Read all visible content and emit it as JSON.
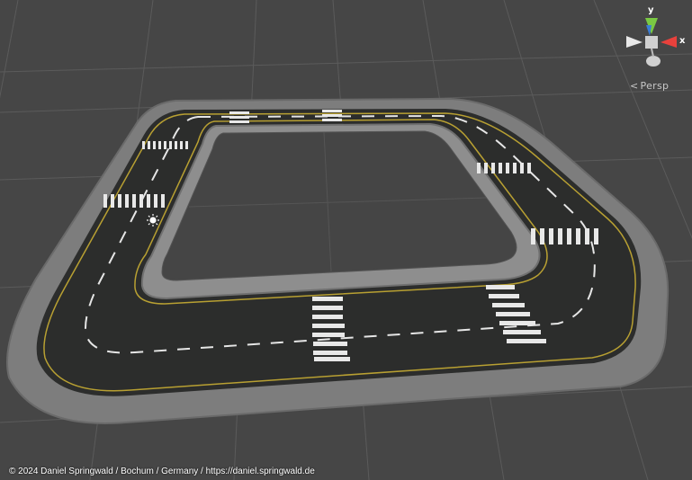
{
  "scene": {
    "view_mode": "Persp",
    "gizmo": {
      "y_label": "y",
      "x_label": "x"
    },
    "colors": {
      "background": "#464646",
      "grid_line": "#5c5c5c",
      "curb": "#8a8a8a",
      "curb_dark": "#6e6e6e",
      "asphalt": "#2a2b2a",
      "edge_line": "#b8a032",
      "lane_marking": "#e8e8e8",
      "gizmo_y": "#7ac943",
      "gizmo_x": "#e8413c",
      "gizmo_z": "#3a7fd5"
    },
    "objects": [
      "light-icon",
      "road-track"
    ]
  },
  "footer": {
    "copyright": "© 2024 Daniel Springwald / Bochum / Germany / https://daniel.springwald.de"
  }
}
